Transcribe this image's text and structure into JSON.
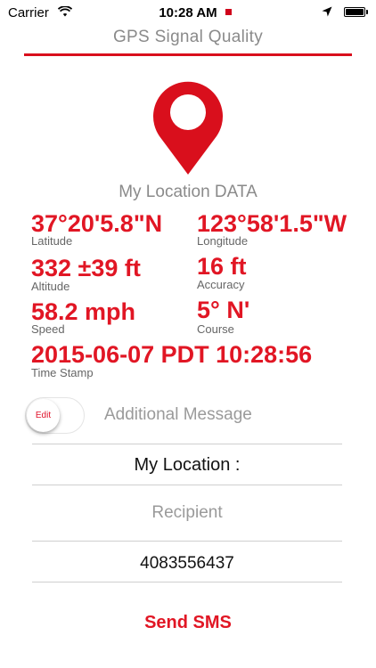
{
  "status_bar": {
    "carrier": "Carrier",
    "time": "10:28 AM"
  },
  "header": {
    "title": "GPS Signal Quality"
  },
  "section": {
    "title": "My Location DATA"
  },
  "data": {
    "latitude": {
      "value": "37°20'5.8\"N",
      "label": "Latitude"
    },
    "longitude": {
      "value": "123°58'1.5\"W",
      "label": "Longitude"
    },
    "altitude": {
      "value": "332 ±39 ft",
      "label": "Altitude"
    },
    "accuracy": {
      "value": "16 ft",
      "label": "Accuracy"
    },
    "speed": {
      "value": "58.2 mph",
      "label": "Speed"
    },
    "course": {
      "value": "5° N'",
      "label": "Course"
    },
    "timestamp": {
      "value": "2015-06-07 PDT 10:28:56",
      "label": "Time Stamp"
    }
  },
  "message": {
    "toggle_label": "Edit",
    "label": "Additional Message",
    "text": "My Location :"
  },
  "recipient": {
    "placeholder": "Recipient",
    "value": "4083556437"
  },
  "actions": {
    "send": "Send SMS"
  },
  "colors": {
    "accent": "#e11624",
    "muted": "#8a8a8a"
  },
  "icons": [
    "wifi-icon",
    "location-arrow-icon",
    "battery-icon",
    "map-pin-icon"
  ]
}
